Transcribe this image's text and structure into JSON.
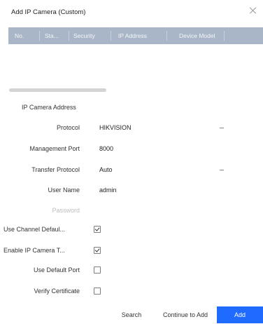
{
  "dialog": {
    "title": "Add IP Camera (Custom)"
  },
  "table": {
    "columns": [
      "No.",
      "Sta...",
      "Security",
      "IP Address",
      "Device Model"
    ]
  },
  "form": {
    "section_title": "IP Camera Address",
    "protocol_label": "Protocol",
    "protocol_value": "HIKVISION",
    "management_port_label": "Management Port",
    "management_port_value": "8000",
    "transfer_protocol_label": "Transfer Protocol",
    "transfer_protocol_value": "Auto",
    "user_name_label": "User Name",
    "user_name_value": "admin",
    "password_label": "Password",
    "use_channel_default_label": "Use Channel Defaul...",
    "use_channel_default_checked": true,
    "enable_ip_camera_label": "Enable IP Camera T...",
    "enable_ip_camera_checked": true,
    "use_default_port_label": "Use Default Port",
    "use_default_port_checked": false,
    "verify_certificate_label": "Verify Certificate",
    "verify_certificate_checked": false
  },
  "footer": {
    "search": "Search",
    "continue": "Continue to Add",
    "add": "Add"
  }
}
